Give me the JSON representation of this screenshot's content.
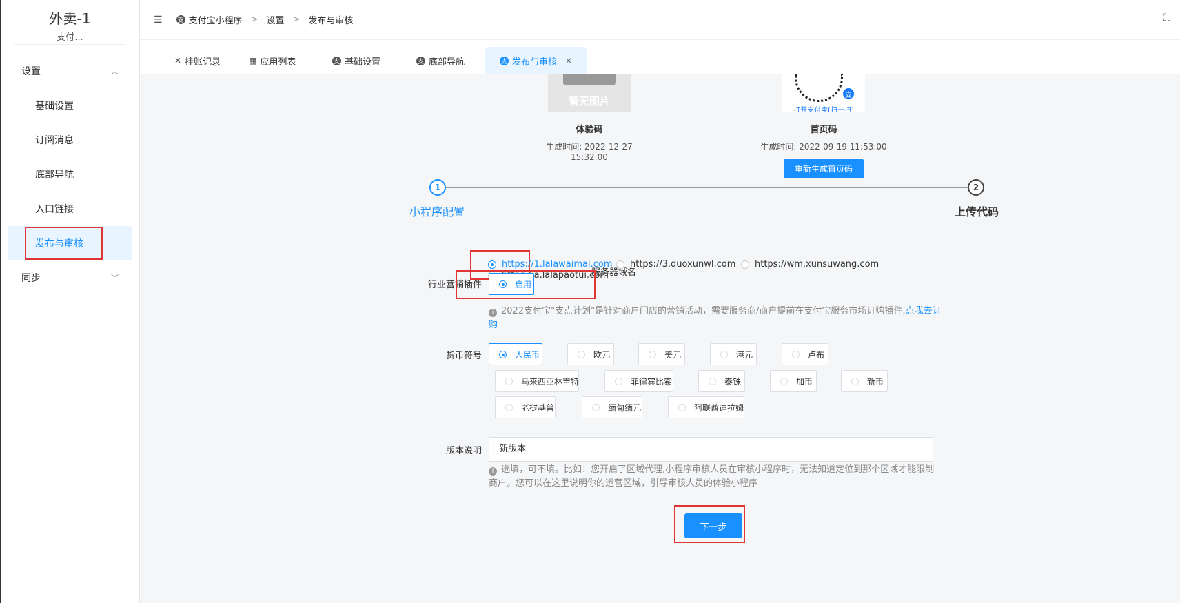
{
  "sidebar": {
    "brand_title": "外卖-1",
    "brand_sub": "支付...",
    "group1": "设置",
    "items": [
      {
        "label": "基础设置"
      },
      {
        "label": "订阅消息"
      },
      {
        "label": "底部导航"
      },
      {
        "label": "入口链接"
      },
      {
        "label": "发布与审核"
      }
    ],
    "group2": "同步"
  },
  "header": {
    "breadcrumb": [
      "支付宝小程序",
      "设置",
      "发布与审核"
    ],
    "sep": ">"
  },
  "tabs": [
    {
      "label": "挂账记录"
    },
    {
      "label": "应用列表"
    },
    {
      "label": "基础设置"
    },
    {
      "label": "底部导航"
    },
    {
      "label": "发布与审核"
    }
  ],
  "qr": {
    "trial": {
      "placeholder": "暂无图片",
      "title": "体验码",
      "time": "生成时间: 2022-12-27 15:32:00"
    },
    "home": {
      "caption": "打开支付宝[扫一扫]",
      "title": "首页码",
      "time": "生成时间: 2022-09-19 11:53:00",
      "regen_label": "重新生成首页码"
    }
  },
  "steps": [
    {
      "num": "1",
      "label": "小程序配置",
      "active": true
    },
    {
      "num": "2",
      "label": "上传代码",
      "active": false
    }
  ],
  "form": {
    "server_label": "服务器域名",
    "server_options": [
      {
        "label": "https://1.lalawaimai.com",
        "checked": true
      },
      {
        "label": "https://3.duoxunwl.com",
        "checked": false
      },
      {
        "label": "https://wm.xunsuwang.com",
        "checked": false
      },
      {
        "label": "https://a.lalapaotui.com",
        "checked": false
      }
    ],
    "plugin_label": "行业营销插件",
    "plugin_option": "启用",
    "plugin_hint": "2022支付宝\"支点计划\"是针对商户门店的营销活动，需要服务商/商户提前在支付宝服务市场订购插件,",
    "plugin_hint_link1": "点我去订",
    "plugin_hint_link2": "购",
    "currency_label": "货币符号",
    "currencies": [
      "人民币",
      "欧元",
      "美元",
      "港元",
      "卢布",
      "马来西亚林吉特",
      "菲律宾比索",
      "泰铢",
      "加币",
      "新币",
      "老挝基普",
      "缅甸缅元",
      "阿联酋迪拉姆"
    ],
    "version_label": "版本说明",
    "version_value": "新版本",
    "version_hint1": "选填，可不填。比如：您开启了区域代理,小程序审核人员在审核小程序时，无法知道定位到那个区域才能限制",
    "version_hint2": "商户。您可以在这里说明你的运营区域，引导审核人员的体验小程序",
    "next_label": "下一步"
  },
  "colors": {
    "accent": "#1890ff",
    "highlight": "#e03535"
  }
}
